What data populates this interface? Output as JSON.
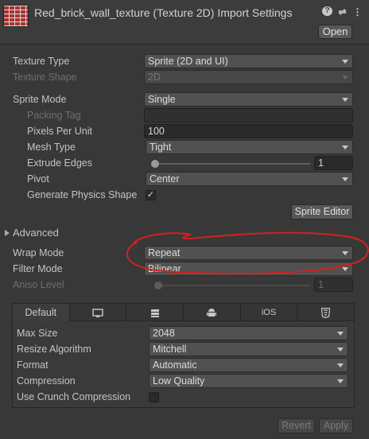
{
  "header": {
    "title": "Red_brick_wall_texture (Texture 2D) Import Settings",
    "help_icon": "?",
    "settings_icon": "⇌",
    "menu_icon": "⋮",
    "open_label": "Open"
  },
  "settings": {
    "texture_type_label": "Texture Type",
    "texture_type_value": "Sprite (2D and UI)",
    "texture_shape_label": "Texture Shape",
    "texture_shape_value": "2D",
    "sprite_mode_label": "Sprite Mode",
    "sprite_mode_value": "Single",
    "packing_tag_label": "Packing Tag",
    "packing_tag_value": "",
    "pixels_per_unit_label": "Pixels Per Unit",
    "pixels_per_unit_value": "100",
    "mesh_type_label": "Mesh Type",
    "mesh_type_value": "Tight",
    "extrude_edges_label": "Extrude Edges",
    "extrude_edges_value": "1",
    "pivot_label": "Pivot",
    "pivot_value": "Center",
    "generate_physics_label": "Generate Physics Shape",
    "generate_physics_checked": "✓",
    "sprite_editor_label": "Sprite Editor",
    "advanced_label": "Advanced",
    "wrap_mode_label": "Wrap Mode",
    "wrap_mode_value": "Repeat",
    "filter_mode_label": "Filter Mode",
    "filter_mode_value": "Bilinear",
    "aniso_level_label": "Aniso Level",
    "aniso_level_value": "1"
  },
  "platform": {
    "tabs": [
      {
        "label": "Default",
        "icon": ""
      },
      {
        "label": "",
        "icon": "monitor-icon"
      },
      {
        "label": "",
        "icon": "server-icon"
      },
      {
        "label": "",
        "icon": "android-icon"
      },
      {
        "label": "iOS",
        "icon": ""
      },
      {
        "label": "",
        "icon": "html5-icon"
      }
    ],
    "max_size_label": "Max Size",
    "max_size_value": "2048",
    "resize_algorithm_label": "Resize Algorithm",
    "resize_algorithm_value": "Mitchell",
    "format_label": "Format",
    "format_value": "Automatic",
    "compression_label": "Compression",
    "compression_value": "Low Quality",
    "crunch_label": "Use Crunch Compression"
  },
  "footer": {
    "revert_label": "Revert",
    "apply_label": "Apply"
  },
  "colors": {
    "background": "#383838",
    "annotation": "#d42020"
  }
}
